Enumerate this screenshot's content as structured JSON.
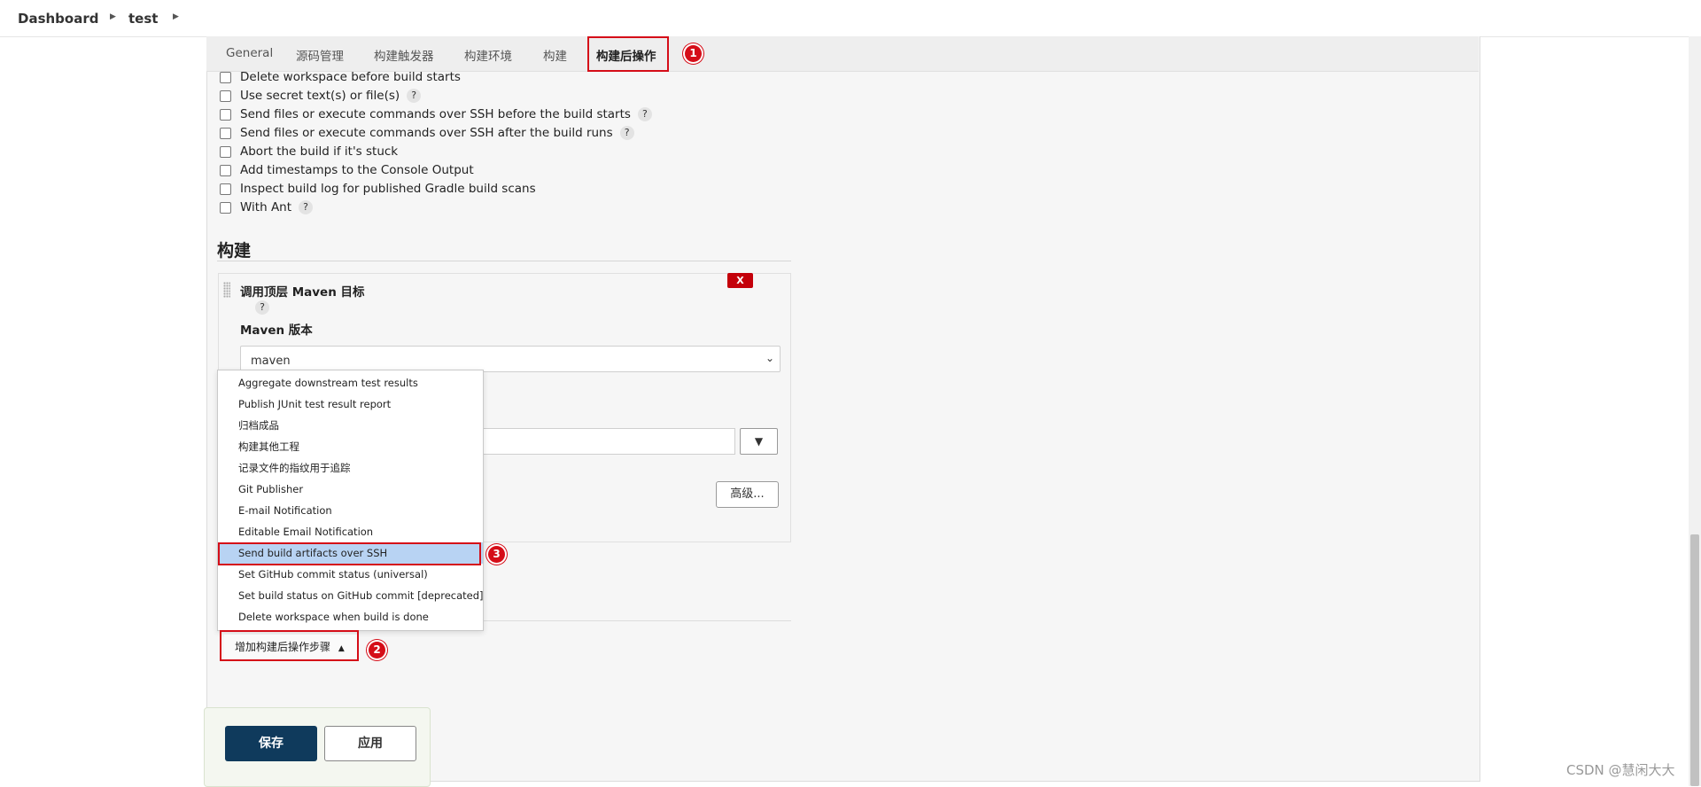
{
  "breadcrumb": {
    "items": [
      "Dashboard",
      "test"
    ]
  },
  "tabs": [
    {
      "label": "General",
      "active": false
    },
    {
      "label": "源码管理",
      "active": false
    },
    {
      "label": "构建触发器",
      "active": false
    },
    {
      "label": "构建环境",
      "active": false
    },
    {
      "label": "构建",
      "active": false
    },
    {
      "label": "构建后操作",
      "active": true
    }
  ],
  "annotations": [
    "1",
    "2",
    "3"
  ],
  "build_env_options": [
    {
      "label": "Delete workspace before build starts",
      "checked": false,
      "help": ""
    },
    {
      "label": "Use secret text(s) or file(s)",
      "checked": false,
      "help": "?"
    },
    {
      "label": "Send files or execute commands over SSH before the build starts",
      "checked": false,
      "help": "?"
    },
    {
      "label": "Send files or execute commands over SSH after the build runs",
      "checked": false,
      "help": "?"
    },
    {
      "label": "Abort the build if it's stuck",
      "checked": false,
      "help": ""
    },
    {
      "label": "Add timestamps to the Console Output",
      "checked": false,
      "help": ""
    },
    {
      "label": "Inspect build log for published Gradle build scans",
      "checked": false,
      "help": ""
    },
    {
      "label": "With Ant",
      "checked": false,
      "help": "?"
    }
  ],
  "build_section": {
    "title": "构建",
    "delete_label": "X",
    "step_title": "调用顶层 Maven 目标",
    "help": "?",
    "maven_label": "Maven 版本",
    "maven_value": "maven",
    "dropdown_arrow": "▼",
    "advanced_label": "高级..."
  },
  "post_build_menu": {
    "items": [
      "Aggregate downstream test results",
      "Publish JUnit test result report",
      "归档成品",
      "构建其他工程",
      "记录文件的指纹用于追踪",
      "Git Publisher",
      "E-mail Notification",
      "Editable Email Notification",
      "Send build artifacts over SSH",
      "Set GitHub commit status (universal)",
      "Set build status on GitHub commit [deprecated]",
      "Delete workspace when build is done"
    ],
    "selected": "Send build artifacts over SSH"
  },
  "add_step_button": {
    "label": "增加构建后操作步骤"
  },
  "footer": {
    "save_label": "保存",
    "apply_label": "应用"
  },
  "watermark": "CSDN @慧闲大大",
  "colors": {
    "highlight": "#d50d18",
    "save_bg": "#0f3a5c",
    "delete_bg": "#c4000a",
    "menu_selected": "#b8d3f3"
  }
}
